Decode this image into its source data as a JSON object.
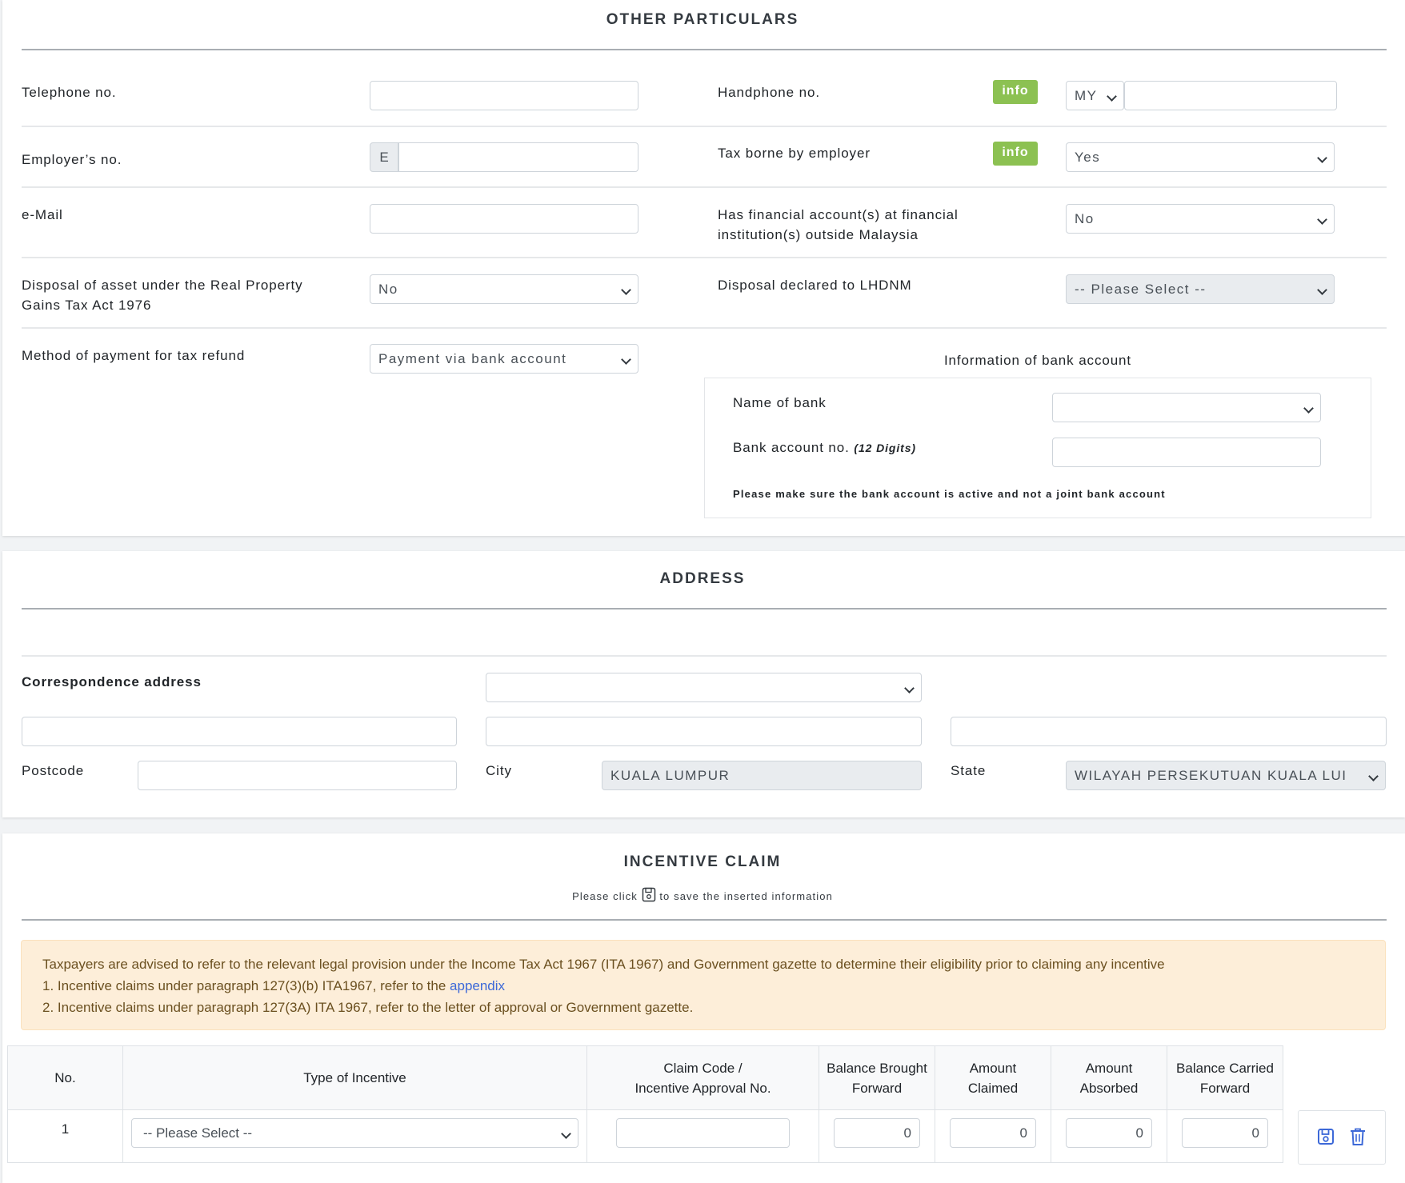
{
  "other": {
    "title": "OTHER PARTICULARS",
    "telephone_label": "Telephone no.",
    "handphone_label": "Handphone no.",
    "info_badge": "info",
    "country_code": "MY",
    "employer_label": "Employer’s no.",
    "employer_prefix": "E",
    "tax_borne_label": "Tax borne by employer",
    "tax_borne_value": "Yes",
    "email_label": "e-Mail",
    "financial_label_1": "Has financial account(s) at financial",
    "financial_label_2": "institution(s) outside Malaysia",
    "financial_value": "No",
    "disposal_label_1": "Disposal of asset under the Real Property",
    "disposal_label_2": "Gains Tax Act 1976",
    "disposal_value": "No",
    "declared_label": "Disposal declared to LHDNM",
    "declared_value": "-- Please Select --",
    "method_label": "Method of payment for tax refund",
    "method_value": "Payment via bank account",
    "bank": {
      "title": "Information of bank account",
      "name_label": "Name of bank",
      "account_label": "Bank account no.",
      "account_hint": "(12 Digits)",
      "note": "Please make sure the bank account is active and not a joint bank account"
    }
  },
  "address": {
    "title": "ADDRESS",
    "correspondence_label": "Correspondence address",
    "postcode_label": "Postcode",
    "city_label": "City",
    "city_value": "KUALA LUMPUR",
    "state_label": "State",
    "state_value": "WILAYAH PERSEKUTUAN KUALA LUI"
  },
  "incentive": {
    "title": "INCENTIVE CLAIM",
    "hint_before": "Please click",
    "hint_after": "to save the inserted information",
    "alert": {
      "line1": "Taxpayers are advised to refer to the relevant legal provision under the Income Tax Act 1967 (ITA 1967) and Government gazette to determine their eligibility prior to claiming any incentive",
      "line2_before": "1. Incentive claims under paragraph 127(3)(b) ITA1967, refer to the",
      "line2_link": "appendix",
      "line3": "2. Incentive claims under paragraph 127(3A) ITA 1967, refer to the letter of approval or Government gazette."
    },
    "columns": {
      "no": "No.",
      "type": "Type of Incentive",
      "code_1": "Claim Code /",
      "code_2": "Incentive Approval No.",
      "bbf_1": "Balance Brought",
      "bbf_2": "Forward",
      "claimed_1": "Amount",
      "claimed_2": "Claimed",
      "absorbed_1": "Amount",
      "absorbed_2": "Absorbed",
      "bcf_1": "Balance Carried",
      "bcf_2": "Forward"
    },
    "row": {
      "no": "1",
      "type_value": "-- Please Select --",
      "bbf": "0",
      "claimed": "0",
      "absorbed": "0",
      "bcf": "0"
    }
  },
  "colors": {
    "info_badge": "#8cc152",
    "alert_bg": "#fdeed9",
    "link": "#3d69d8",
    "action_icon": "#3d69d8"
  }
}
